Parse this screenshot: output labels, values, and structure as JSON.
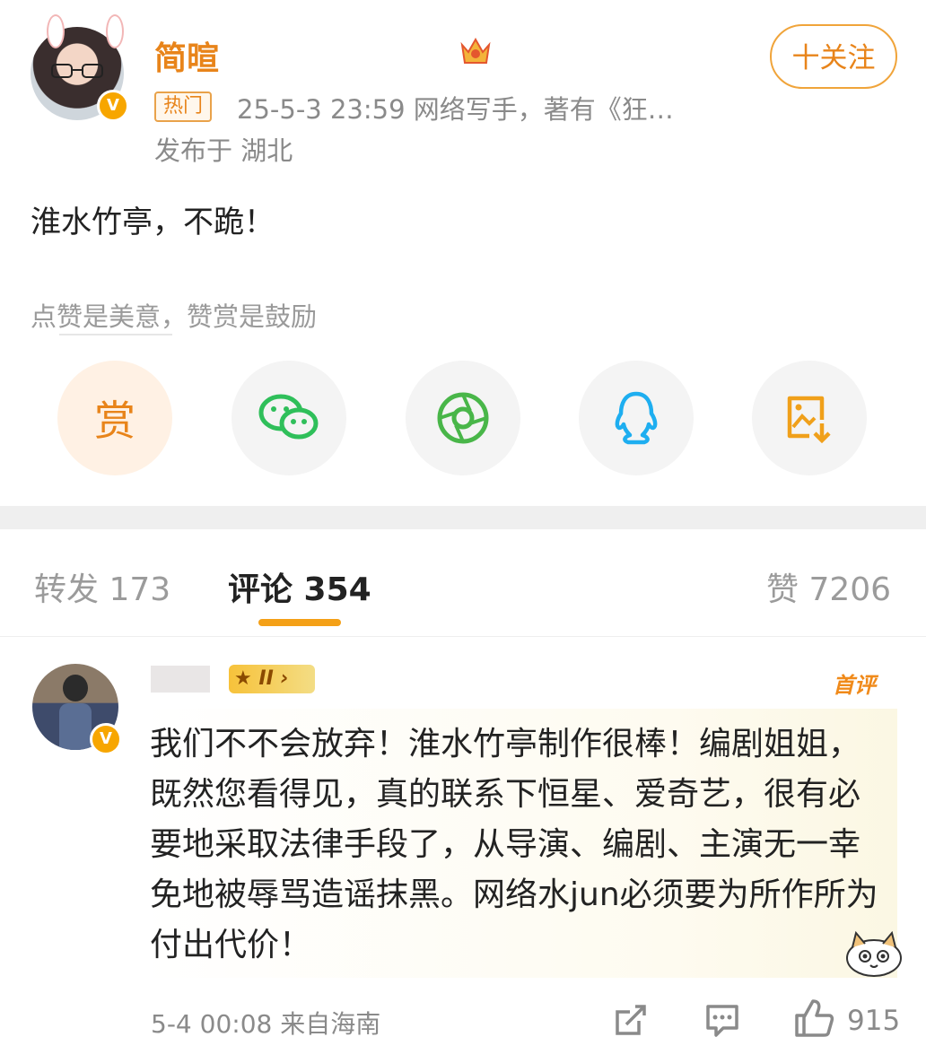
{
  "post": {
    "author": "简暄",
    "hot_tag": "热门",
    "meta": "25-5-3 23:59  网络写手，著有《狂…",
    "location": "发布于 湖北",
    "follow_label": "十关注",
    "content": "淮水竹亭，不跪！",
    "reward_hint": "点赞是美意，赞赏是鼓励",
    "reward_label": "赏",
    "share_icons": [
      "reward-icon",
      "wechat-icon",
      "moments-icon",
      "qq-icon",
      "save-image-icon"
    ]
  },
  "tabs": {
    "repost": "转发 173",
    "comments": "评论 354",
    "likes": "赞 7206"
  },
  "comment": {
    "level_badge": "II",
    "first_comment_tag": "首评",
    "text": "我们不不会放弃！淮水竹亭制作很棒！编剧姐姐，既然您看得见，真的联系下恒星、爱奇艺，很有必要地采取法律手段了，从导演、编剧、主演无一幸免地被辱骂造谣抹黑。网络水jun必须要为所作所为付出代价！",
    "time": "5-4 00:08  来自海南",
    "like_count": "915"
  },
  "colors": {
    "accent": "#e8841a",
    "tab_underline": "#f4a017",
    "muted": "#8a8a8a"
  }
}
